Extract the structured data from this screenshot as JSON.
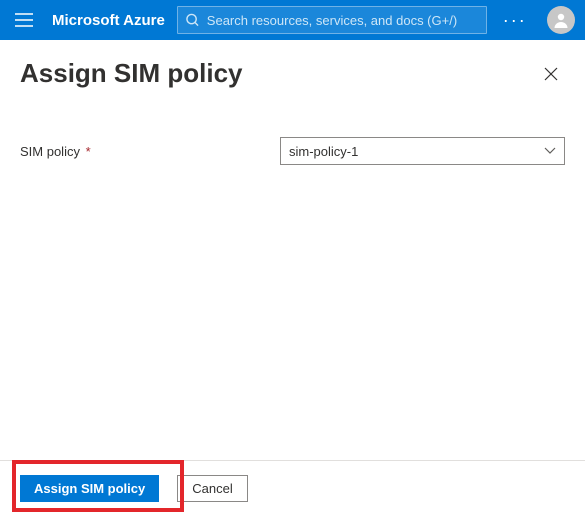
{
  "topbar": {
    "brand": "Microsoft Azure",
    "search_placeholder": "Search resources, services, and docs (G+/)"
  },
  "panel": {
    "title": "Assign SIM policy"
  },
  "form": {
    "sim_policy_label": "SIM policy",
    "sim_policy_required_marker": "*",
    "sim_policy_value": "sim-policy-1"
  },
  "footer": {
    "assign_label": "Assign SIM policy",
    "cancel_label": "Cancel"
  },
  "colors": {
    "brand_blue": "#0078d4",
    "highlight_red": "#e3262b"
  }
}
